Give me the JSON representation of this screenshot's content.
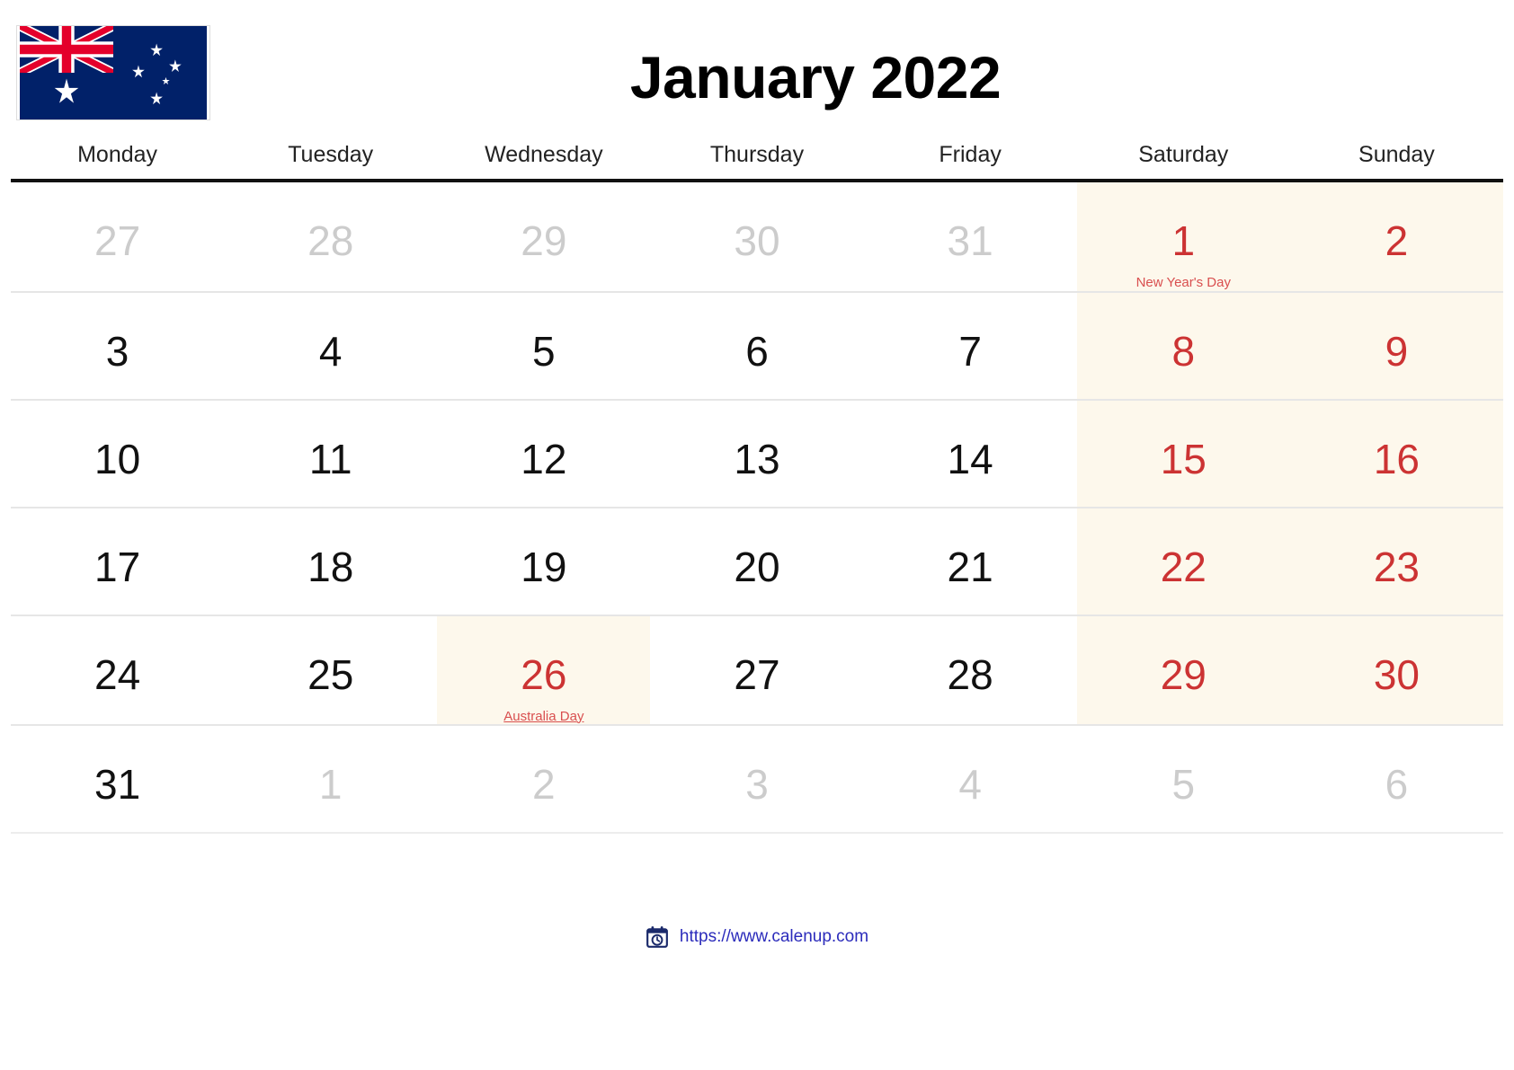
{
  "header": {
    "title": "January 2022",
    "flag_name": "australia-flag",
    "flag_colors": {
      "navy": "#012169",
      "red": "#E4002B",
      "white": "#FFFFFF"
    }
  },
  "weekdays": [
    "Monday",
    "Tuesday",
    "Wednesday",
    "Thursday",
    "Friday",
    "Saturday",
    "Sunday"
  ],
  "colors": {
    "weekend_red": "#cc3333",
    "out_of_month_gray": "#cccccc",
    "shade_cream": "#fdf8ec",
    "header_rule": "#111111",
    "row_rule": "#e6e6e6",
    "link_blue": "#2b2bbb"
  },
  "weeks": [
    {
      "days": [
        {
          "n": "27",
          "type": "out"
        },
        {
          "n": "28",
          "type": "out"
        },
        {
          "n": "29",
          "type": "out"
        },
        {
          "n": "30",
          "type": "out"
        },
        {
          "n": "31",
          "type": "out"
        },
        {
          "n": "1",
          "type": "weekend",
          "shade": true,
          "holiday": "New Year's Day",
          "linked": false
        },
        {
          "n": "2",
          "type": "weekend",
          "shade": true
        }
      ]
    },
    {
      "days": [
        {
          "n": "3",
          "type": "day"
        },
        {
          "n": "4",
          "type": "day"
        },
        {
          "n": "5",
          "type": "day"
        },
        {
          "n": "6",
          "type": "day"
        },
        {
          "n": "7",
          "type": "day"
        },
        {
          "n": "8",
          "type": "weekend",
          "shade": true
        },
        {
          "n": "9",
          "type": "weekend",
          "shade": true
        }
      ]
    },
    {
      "days": [
        {
          "n": "10",
          "type": "day"
        },
        {
          "n": "11",
          "type": "day"
        },
        {
          "n": "12",
          "type": "day"
        },
        {
          "n": "13",
          "type": "day"
        },
        {
          "n": "14",
          "type": "day"
        },
        {
          "n": "15",
          "type": "weekend",
          "shade": true
        },
        {
          "n": "16",
          "type": "weekend",
          "shade": true
        }
      ]
    },
    {
      "days": [
        {
          "n": "17",
          "type": "day"
        },
        {
          "n": "18",
          "type": "day"
        },
        {
          "n": "19",
          "type": "day"
        },
        {
          "n": "20",
          "type": "day"
        },
        {
          "n": "21",
          "type": "day"
        },
        {
          "n": "22",
          "type": "weekend",
          "shade": true
        },
        {
          "n": "23",
          "type": "weekend",
          "shade": true
        }
      ]
    },
    {
      "days": [
        {
          "n": "24",
          "type": "day"
        },
        {
          "n": "25",
          "type": "day"
        },
        {
          "n": "26",
          "type": "holiday",
          "shade": true,
          "holiday": "Australia Day",
          "linked": true
        },
        {
          "n": "27",
          "type": "day"
        },
        {
          "n": "28",
          "type": "day"
        },
        {
          "n": "29",
          "type": "weekend",
          "shade": true
        },
        {
          "n": "30",
          "type": "weekend",
          "shade": true
        }
      ]
    },
    {
      "last": true,
      "days": [
        {
          "n": "31",
          "type": "day"
        },
        {
          "n": "1",
          "type": "out"
        },
        {
          "n": "2",
          "type": "out"
        },
        {
          "n": "3",
          "type": "out"
        },
        {
          "n": "4",
          "type": "out"
        },
        {
          "n": "5",
          "type": "out"
        },
        {
          "n": "6",
          "type": "out"
        }
      ]
    }
  ],
  "footer": {
    "icon_name": "calendar-clock-icon",
    "url": "https://www.calenup.com"
  }
}
